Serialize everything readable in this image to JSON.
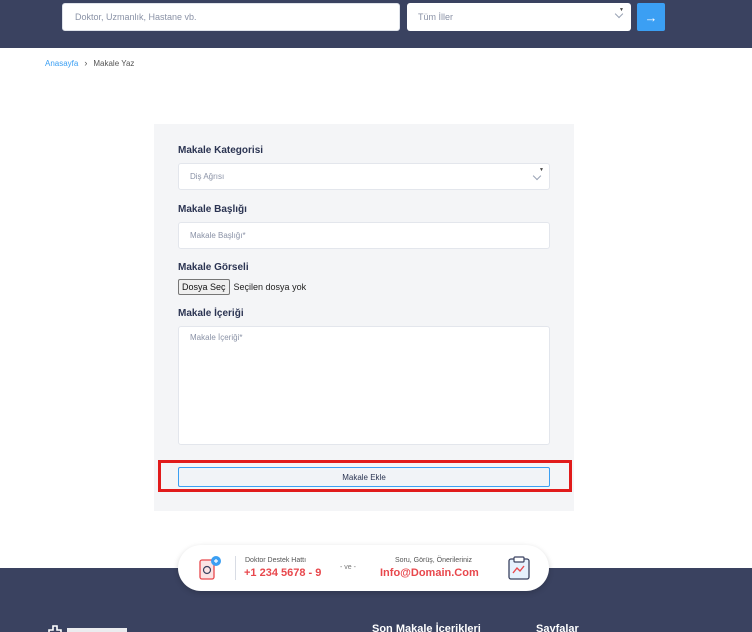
{
  "header": {
    "search_placeholder": "Doktor, Uzmanlık, Hastane vb.",
    "city_select_value": "Tüm İller",
    "go_button_glyph": "→"
  },
  "breadcrumb": {
    "home": "Anasayfa",
    "separator": "›",
    "current": "Makale Yaz"
  },
  "form": {
    "category_label": "Makale Kategorisi",
    "category_value": "Diş Ağrısı",
    "title_label": "Makale Başlığı",
    "title_placeholder": "Makale Başlığı*",
    "image_label": "Makale Görseli",
    "file_button": "Dosya Seç",
    "file_status": "Seçilen dosya yok",
    "content_label": "Makale İçeriği",
    "content_placeholder": "Makale İçeriği*",
    "submit_label": "Makale Ekle"
  },
  "contact": {
    "support_label": "Doktor Destek Hattı",
    "support_phone": "+1 234 5678 - 9",
    "connector": "- ve -",
    "feedback_label": "Soru, Görüş, Önerileriniz",
    "feedback_email": "Info@Domain.Com"
  },
  "footer": {
    "col_articles": "Son Makale İçerikleri",
    "col_pages": "Sayfalar"
  },
  "colors": {
    "header_bg": "#3a4260",
    "accent_blue": "#3b9ff3",
    "accent_red": "#e8474c",
    "highlight_red": "#e11b1b",
    "card_bg": "#f4f5f7"
  }
}
